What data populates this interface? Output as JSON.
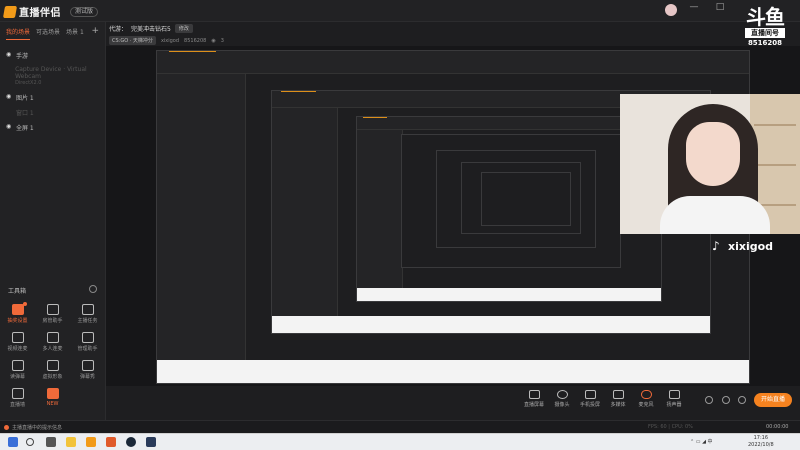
{
  "app": {
    "name": "直播伴侣",
    "version_badge": "测试版",
    "window_controls": [
      "—",
      "□",
      "✕"
    ]
  },
  "sidebar": {
    "tabs": [
      {
        "label": "我的场景",
        "active": true
      },
      {
        "label": "可选场景",
        "active": false
      },
      {
        "label": "场景 1",
        "active": false
      }
    ],
    "add_label": "+",
    "scenes": [
      {
        "label": "手游",
        "sub": "",
        "dim": false
      },
      {
        "label": "Capture Device · Virtual Webcam",
        "sub": "DirectX2.0",
        "dim": true
      },
      {
        "label": "图片 1",
        "sub": "",
        "dim": false
      },
      {
        "label": "窗口 1",
        "sub": "",
        "dim": true
      },
      {
        "label": "全屏 1",
        "sub": "",
        "dim": false
      }
    ],
    "tools_title": "工具箱",
    "tools": [
      {
        "label": "抽奖设置",
        "icon": "gift-icon",
        "hot": true,
        "dot": true
      },
      {
        "label": "房管助手",
        "icon": "user-shield-icon",
        "hot": false,
        "dot": false
      },
      {
        "label": "主播任务",
        "icon": "task-icon",
        "hot": false,
        "dot": false
      },
      {
        "label": "视频连麦",
        "icon": "video-link-icon",
        "hot": false,
        "dot": false
      },
      {
        "label": "多人连麦",
        "icon": "multi-link-icon",
        "hot": false,
        "dot": false
      },
      {
        "label": "管理助手",
        "icon": "manage-icon",
        "hot": false,
        "dot": false
      },
      {
        "label": "读弹幕",
        "icon": "danmaku-icon",
        "hot": false,
        "dot": false
      },
      {
        "label": "虚拟形象",
        "icon": "avatar-icon",
        "hot": false,
        "dot": false
      },
      {
        "label": "弹幕秀",
        "icon": "tv-icon",
        "hot": false,
        "dot": false
      },
      {
        "label": "直播墙",
        "icon": "wall-icon",
        "hot": false,
        "dot": false
      },
      {
        "label": "NEW",
        "icon": "new-icon",
        "hot": true,
        "dot": false
      }
    ]
  },
  "stream": {
    "title_prefix": "代游：",
    "title": "完美冲击钻石5",
    "title_tag": "修改",
    "category": "CS:GO · 天梯冲分",
    "user": "xixigod",
    "room_id": "8516208",
    "viewers": "3"
  },
  "overlay": {
    "douyu_logo": "斗鱼",
    "douyu_tag": "直播间号",
    "room_number": "8516208",
    "tiktok_handle": "xixigod"
  },
  "bottom_toolbar": [
    {
      "label": "直播屏幕",
      "icon": "screen-icon"
    },
    {
      "label": "摄像头",
      "icon": "camera-icon"
    },
    {
      "label": "手机投屏",
      "icon": "phone-cast-icon"
    },
    {
      "label": "多媒体",
      "icon": "media-icon"
    },
    {
      "label": "麦克风",
      "icon": "mic-icon"
    },
    {
      "label": "扬声器",
      "icon": "speaker-icon"
    }
  ],
  "go_live_label": "开始直播",
  "statusbar": {
    "notice": "主播直播中的提示信息",
    "stats": "FPS: 60  |  CPU: 0%",
    "timer": "00:00:00"
  },
  "taskbar": {
    "time": "17:16",
    "date": "2022/10/8"
  }
}
